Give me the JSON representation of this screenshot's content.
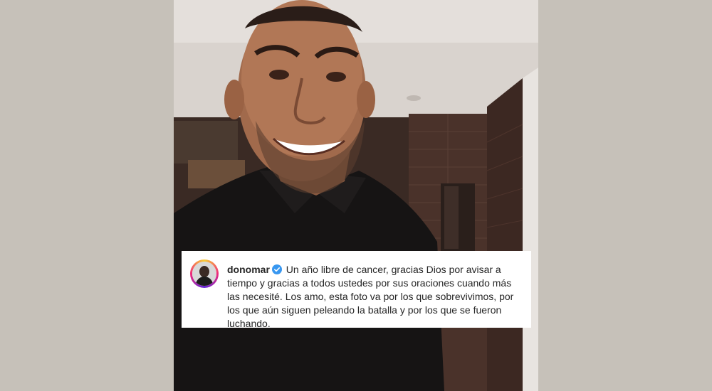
{
  "post": {
    "username": "donomar",
    "verified_badge_color": "#3897f0",
    "caption": "Un año libre de cancer, gracias Dios por avisar a tiempo y gracias a todos ustedes por sus oraciones cuando más las necesité. Los amo, esta foto va por los que sobrevivimos, por los que aún siguen peleando la batalla y por los que se fueron luchando.",
    "avatar_ring_colors": [
      "#f9ce34",
      "#ee2a7b",
      "#6228d7"
    ]
  },
  "background_color": "#c6c1b9",
  "icons": {
    "verified": "verified-badge-icon",
    "avatar": "profile-avatar"
  }
}
